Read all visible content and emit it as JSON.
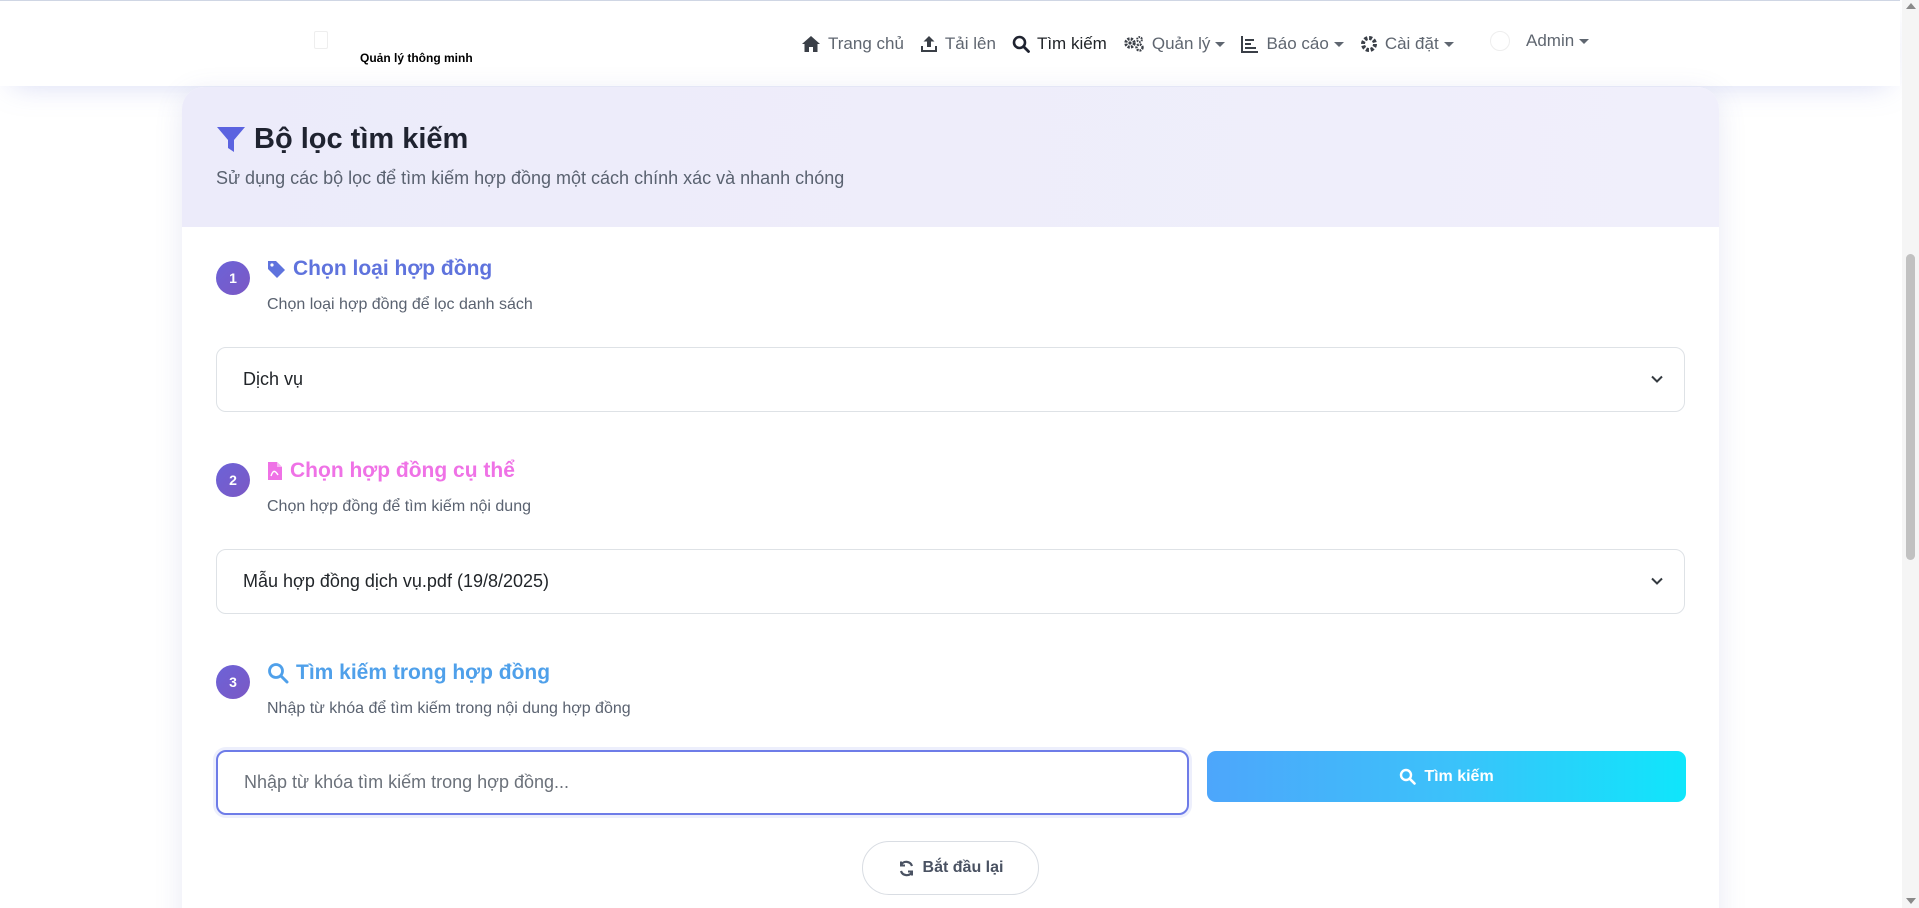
{
  "brand": {
    "subtitle": "Quản lý thông minh"
  },
  "nav": {
    "items": [
      {
        "label": "Trang chủ",
        "icon": "home-icon",
        "dropdown": false
      },
      {
        "label": "Tải lên",
        "icon": "upload-icon",
        "dropdown": false
      },
      {
        "label": "Tìm kiếm",
        "icon": "search-icon",
        "dropdown": false,
        "active": true
      },
      {
        "label": "Quản lý",
        "icon": "gears-icon",
        "dropdown": true
      },
      {
        "label": "Báo cáo",
        "icon": "chart-icon",
        "dropdown": true
      },
      {
        "label": "Cài đặt",
        "icon": "gear-icon",
        "dropdown": true
      }
    ],
    "user": "Admin"
  },
  "filter": {
    "title": "Bộ lọc tìm kiếm",
    "subtitle": "Sử dụng các bộ lọc để tìm kiếm hợp đồng một cách chính xác và nhanh chóng",
    "steps": [
      {
        "number": "1",
        "title": "Chọn loại hợp đồng",
        "desc": "Chọn loại hợp đồng để lọc danh sách",
        "color": "#5f73dd",
        "icon": "tag-icon"
      },
      {
        "number": "2",
        "title": "Chọn hợp đồng cụ thể",
        "desc": "Chọn hợp đồng để tìm kiếm nội dung",
        "color": "#ef72e6",
        "icon": "file-pdf-icon"
      },
      {
        "number": "3",
        "title": "Tìm kiếm trong hợp đồng",
        "desc": "Nhập từ khóa để tìm kiếm trong nội dung hợp đồng",
        "color": "#4fa0ea",
        "icon": "search-icon"
      }
    ],
    "contract_type_value": "Dịch vụ",
    "contract_value": "Mẫu hợp đồng dịch vụ.pdf (19/8/2025)",
    "search_placeholder": "Nhập từ khóa tìm kiếm trong hợp đồng...",
    "search_button": "Tìm kiếm",
    "reset_button": "Bắt đầu lại"
  },
  "colors": {
    "accent": "#6e7ce8",
    "step_badge": "#6c63d8",
    "search_gradient_start": "#4da6fb",
    "search_gradient_end": "#0fe6fb"
  }
}
